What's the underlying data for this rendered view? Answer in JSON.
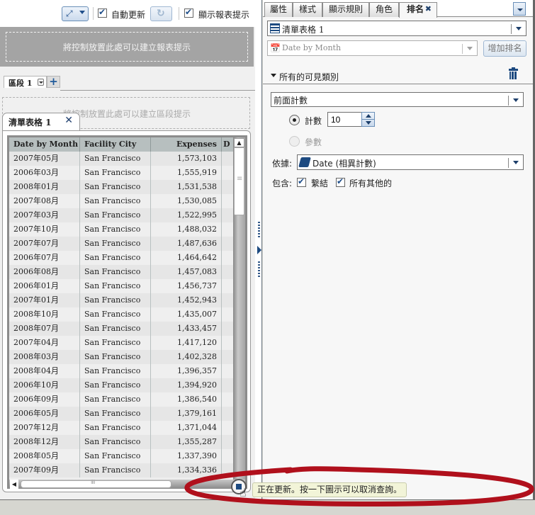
{
  "toolbar": {
    "expand_icon": "expand-arrows-icon",
    "auto_refresh_label": "自動更新",
    "auto_refresh_checked": true,
    "refresh_icon": "refresh-icon",
    "show_report_prompt_label": "顯示報表提示",
    "show_report_prompt_checked": true
  },
  "report_prompt_area": {
    "text": "將控制放置此處可以建立報表提示"
  },
  "sections": {
    "tabs": [
      {
        "label": "區段 1"
      }
    ],
    "add_label": "+"
  },
  "section_prompt_area": {
    "text": "將控制放置此處可以建立區段提示"
  },
  "object_tab": {
    "label": "清單表格 1",
    "close": "✕"
  },
  "table": {
    "columns": [
      "Date by Month",
      "Facility City",
      "Expenses",
      "D"
    ],
    "rows": [
      [
        "2007年05月",
        "San Francisco",
        "1,573,103"
      ],
      [
        "2006年03月",
        "San Francisco",
        "1,555,919"
      ],
      [
        "2008年01月",
        "San Francisco",
        "1,531,538"
      ],
      [
        "2007年08月",
        "San Francisco",
        "1,530,085"
      ],
      [
        "2007年03月",
        "San Francisco",
        "1,522,995"
      ],
      [
        "2007年10月",
        "San Francisco",
        "1,488,032"
      ],
      [
        "2007年07月",
        "San Francisco",
        "1,487,636"
      ],
      [
        "2006年07月",
        "San Francisco",
        "1,464,642"
      ],
      [
        "2006年08月",
        "San Francisco",
        "1,457,083"
      ],
      [
        "2006年01月",
        "San Francisco",
        "1,456,737"
      ],
      [
        "2007年01月",
        "San Francisco",
        "1,452,943"
      ],
      [
        "2008年10月",
        "San Francisco",
        "1,435,007"
      ],
      [
        "2008年07月",
        "San Francisco",
        "1,433,457"
      ],
      [
        "2007年04月",
        "San Francisco",
        "1,417,120"
      ],
      [
        "2008年03月",
        "San Francisco",
        "1,402,328"
      ],
      [
        "2008年04月",
        "San Francisco",
        "1,396,357"
      ],
      [
        "2006年10月",
        "San Francisco",
        "1,394,920"
      ],
      [
        "2006年09月",
        "San Francisco",
        "1,386,540"
      ],
      [
        "2006年05月",
        "San Francisco",
        "1,379,161"
      ],
      [
        "2007年12月",
        "San Francisco",
        "1,371,044"
      ],
      [
        "2008年12月",
        "San Francisco",
        "1,355,287"
      ],
      [
        "2008年05月",
        "San Francisco",
        "1,337,390"
      ],
      [
        "2007年09月",
        "San Francisco",
        "1,334,336"
      ]
    ]
  },
  "right_panel": {
    "tabs": [
      {
        "label": "屬性",
        "active": false
      },
      {
        "label": "樣式",
        "active": false
      },
      {
        "label": "顯示規則",
        "active": false
      },
      {
        "label": "角色",
        "active": false
      },
      {
        "label": "排名",
        "active": true,
        "close": "✖"
      }
    ],
    "object_select": {
      "value": "清單表格 1",
      "icon": "table-icon"
    },
    "rank_category": {
      "placeholder": "Date by Month",
      "icon": "date-calendar-icon"
    },
    "add_rank_label": "增加排名",
    "group": {
      "title": "所有的可見類別",
      "rank_type": "前面計數",
      "count_label": "計數",
      "count_value": "10",
      "count_selected": true,
      "param_label": "參數",
      "by_label": "依據:",
      "by_value": "Date (相異計數)",
      "include_label": "包含:",
      "include_ties_label": "繫結",
      "include_ties_checked": true,
      "include_others_label": "所有其他的",
      "include_others_checked": true
    }
  },
  "status": {
    "tooltip": "正在更新。按一下圖示可以取消查詢。",
    "annotation_color": "#b0101c"
  }
}
